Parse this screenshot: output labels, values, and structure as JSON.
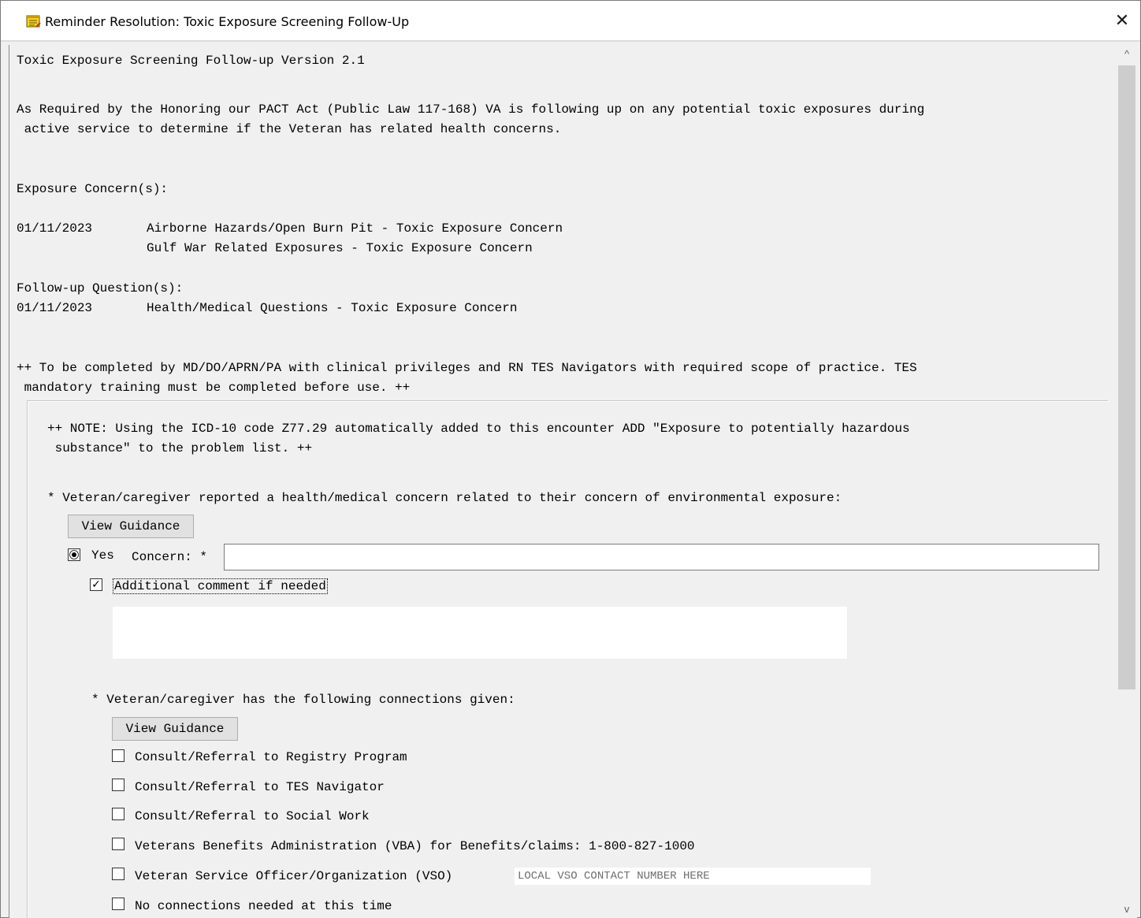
{
  "window": {
    "title": "Reminder Resolution: Toxic Exposure Screening Follow-Up",
    "close_glyph": "✕"
  },
  "header": {
    "version_line": "Toxic Exposure Screening Follow-up Version 2.1",
    "intro_line1": "As Required by the Honoring our PACT Act (Public Law 117-168) VA is following up on any potential toxic exposures during",
    "intro_line2": " active service to determine if the Veteran has related health concerns."
  },
  "exposures": {
    "heading": "Exposure Concern(s):",
    "date": "01/11/2023",
    "items": [
      "Airborne Hazards/Open Burn Pit - Toxic Exposure Concern",
      "Gulf War Related Exposures - Toxic Exposure Concern"
    ]
  },
  "followup": {
    "heading": "Follow-up Question(s):",
    "date": "01/11/2023",
    "item": "Health/Medical Questions - Toxic Exposure Concern"
  },
  "completion_note": {
    "line1": "++ To be completed by MD/DO/APRN/PA with clinical privileges and RN TES Navigators with required scope of practice. TES",
    "line2": " mandatory training must be completed before use. ++"
  },
  "icd_note": {
    "line1": "++ NOTE: Using the ICD-10 code Z77.29 automatically added to this encounter ADD \"Exposure to potentially hazardous",
    "line2": " substance\" to the problem list. ++"
  },
  "health_concern": {
    "question": "* Veteran/caregiver reported a health/medical concern related to their concern of environmental exposure:",
    "guidance_label": "View Guidance",
    "yes_label": "Yes",
    "concern_label": "Concern: *",
    "concern_value": "",
    "additional_comment_label": "Additional comment if needed",
    "additional_comment_value": ""
  },
  "connections": {
    "question": "* Veteran/caregiver has the following connections given:",
    "guidance_label": "View Guidance",
    "items": [
      {
        "label": "Consult/Referral to Registry Program",
        "checked": false
      },
      {
        "label": "Consult/Referral to TES Navigator",
        "checked": false
      },
      {
        "label": "Consult/Referral to Social Work",
        "checked": false
      },
      {
        "label": "Veterans Benefits Administration (VBA) for Benefits/claims: 1-800-827-1000",
        "checked": false
      },
      {
        "label": "Veteran Service Officer/Organization (VSO)",
        "checked": false
      },
      {
        "label": "No connections needed at this time",
        "checked": false
      }
    ],
    "vso_placeholder": "LOCAL VSO CONTACT NUMBER HERE"
  },
  "scrollbar": {
    "up_glyph": "^",
    "down_glyph": "v"
  },
  "colors": {
    "title_icon": "#e8c21c",
    "background": "#f0f0f0"
  }
}
